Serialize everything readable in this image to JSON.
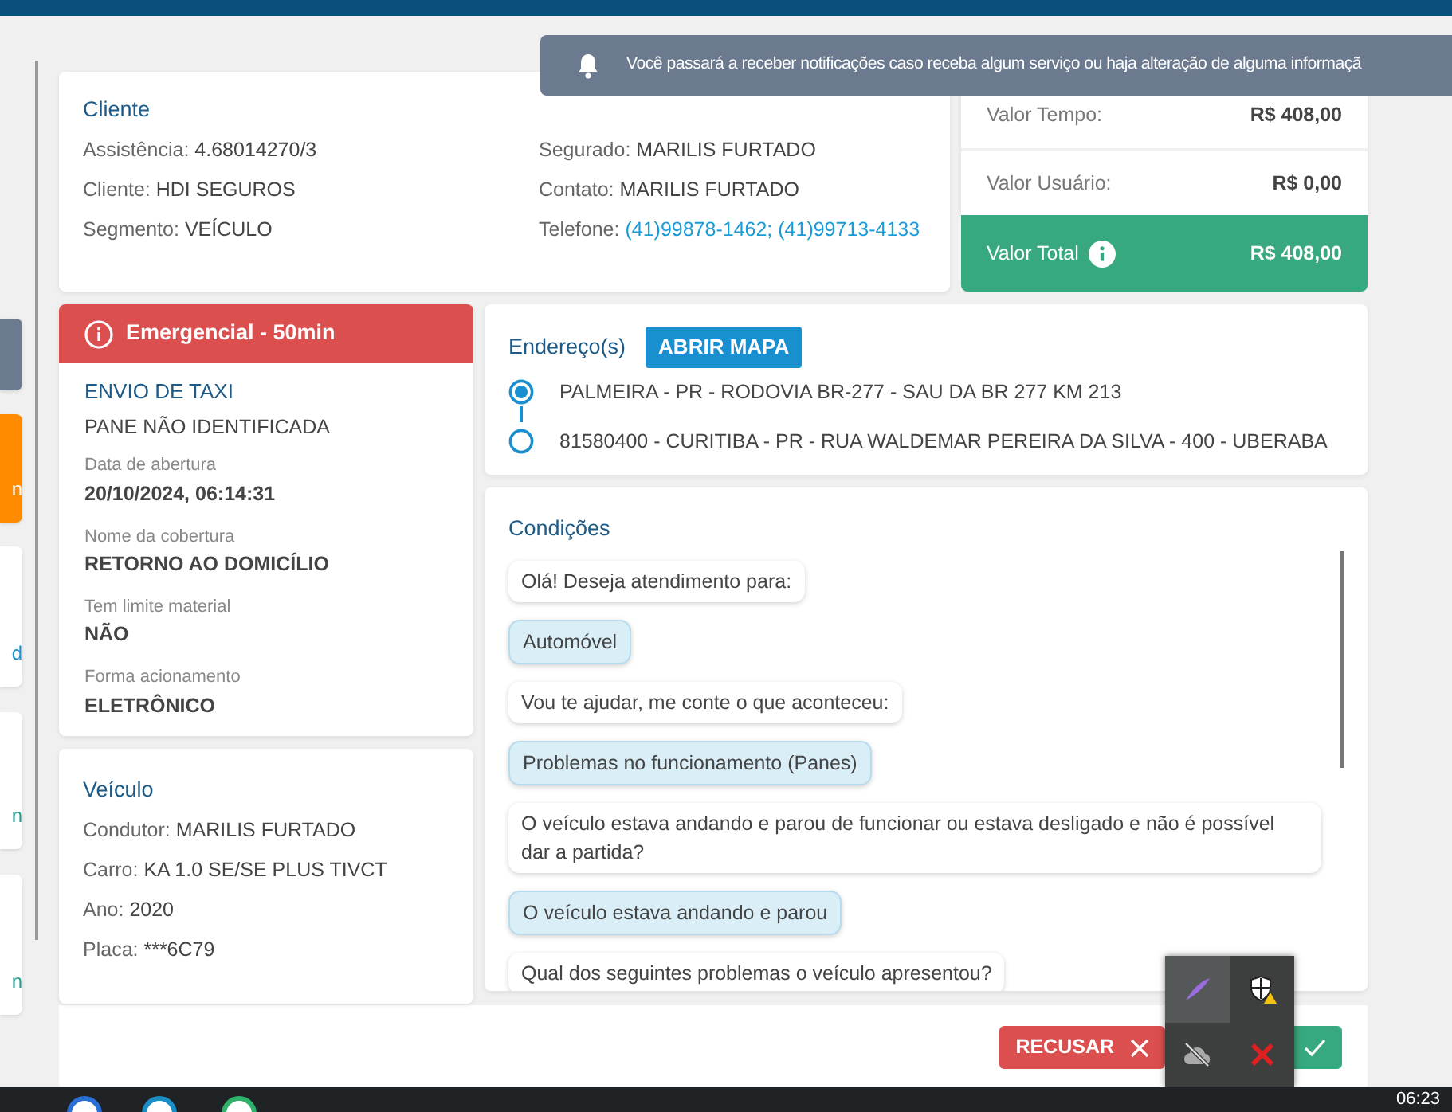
{
  "sidebar_cards": [
    {
      "color": "#6b7a8f"
    },
    {
      "color": "#ff8c00",
      "text": "n"
    },
    {
      "color": "#ffffff",
      "text": "d"
    },
    {
      "color": "#ffffff",
      "text": "n"
    },
    {
      "color": "#ffffff",
      "text": "n"
    }
  ],
  "notification": {
    "text": "Você passará a receber notificações caso receba algum serviço ou haja alteração de alguma informaçã"
  },
  "cliente": {
    "title": "Cliente",
    "left": [
      {
        "label": "Assistência:",
        "value": "4.68014270/3"
      },
      {
        "label": "Cliente:",
        "value": "HDI SEGUROS"
      },
      {
        "label": "Segmento:",
        "value": "VEÍCULO"
      }
    ],
    "right": [
      {
        "label": "Segurado:",
        "value": "MARILIS FURTADO",
        "kind": "text"
      },
      {
        "label": "Contato:",
        "value": "MARILIS FURTADO",
        "kind": "text"
      },
      {
        "label": "Telefone:",
        "value": "(41)99878-1462; (41)99713-4133",
        "kind": "link"
      }
    ]
  },
  "valores": {
    "rows": [
      {
        "label": "Valor Tempo:",
        "value": "R$ 408,00"
      },
      {
        "label": "Valor Usuário:",
        "value": "R$ 0,00"
      }
    ],
    "total": {
      "label": "Valor Total",
      "value": "R$ 408,00"
    }
  },
  "servico": {
    "badge": "Emergencial - 50min",
    "title": "ENVIO DE TAXI",
    "subtitle": "PANE NÃO IDENTIFICADA",
    "fields": [
      {
        "label": "Data de abertura",
        "value": "20/10/2024, 06:14:31"
      },
      {
        "label": "Nome da cobertura",
        "value": "RETORNO AO DOMICÍLIO"
      },
      {
        "label": "Tem limite material",
        "value": "NÃO"
      },
      {
        "label": "Forma acionamento",
        "value": "ELETRÔNICO"
      }
    ]
  },
  "enderecos": {
    "title": "Endereço(s)",
    "button": "ABRIR MAPA",
    "items": [
      {
        "text": "PALMEIRA - PR - RODOVIA BR-277 - SAU DA BR 277 KM 213",
        "selected": true
      },
      {
        "text": "81580400 - CURITIBA - PR - RUA WALDEMAR PEREIRA DA SILVA - 400 - UBERABA",
        "selected": false
      }
    ]
  },
  "veiculo": {
    "title": "Veículo",
    "fields": [
      {
        "label": "Condutor:",
        "value": "MARILIS FURTADO"
      },
      {
        "label": "Carro:",
        "value": "KA 1.0 SE/SE PLUS TIVCT"
      },
      {
        "label": "Ano:",
        "value": "2020"
      },
      {
        "label": "Placa:",
        "value": "***6C79"
      }
    ]
  },
  "condicoes": {
    "title": "Condições",
    "messages": [
      {
        "kind": "question",
        "text": "Olá! Deseja atendimento para:"
      },
      {
        "kind": "answer",
        "text": "Automóvel"
      },
      {
        "kind": "question",
        "text": "Vou te ajudar, me conte o que aconteceu:"
      },
      {
        "kind": "answer",
        "text": "Problemas no funcionamento (Panes)"
      },
      {
        "kind": "question",
        "text": "O veículo estava andando e parou de funcionar ou estava desligado e não é possível dar a partida?"
      },
      {
        "kind": "answer",
        "text": "O veículo estava andando e parou"
      },
      {
        "kind": "question",
        "text": "Qual dos seguintes problemas o veículo apresentou?"
      }
    ]
  },
  "actions": {
    "reject": "RECUSAR"
  },
  "taskbar": {
    "clock": "06:23"
  }
}
